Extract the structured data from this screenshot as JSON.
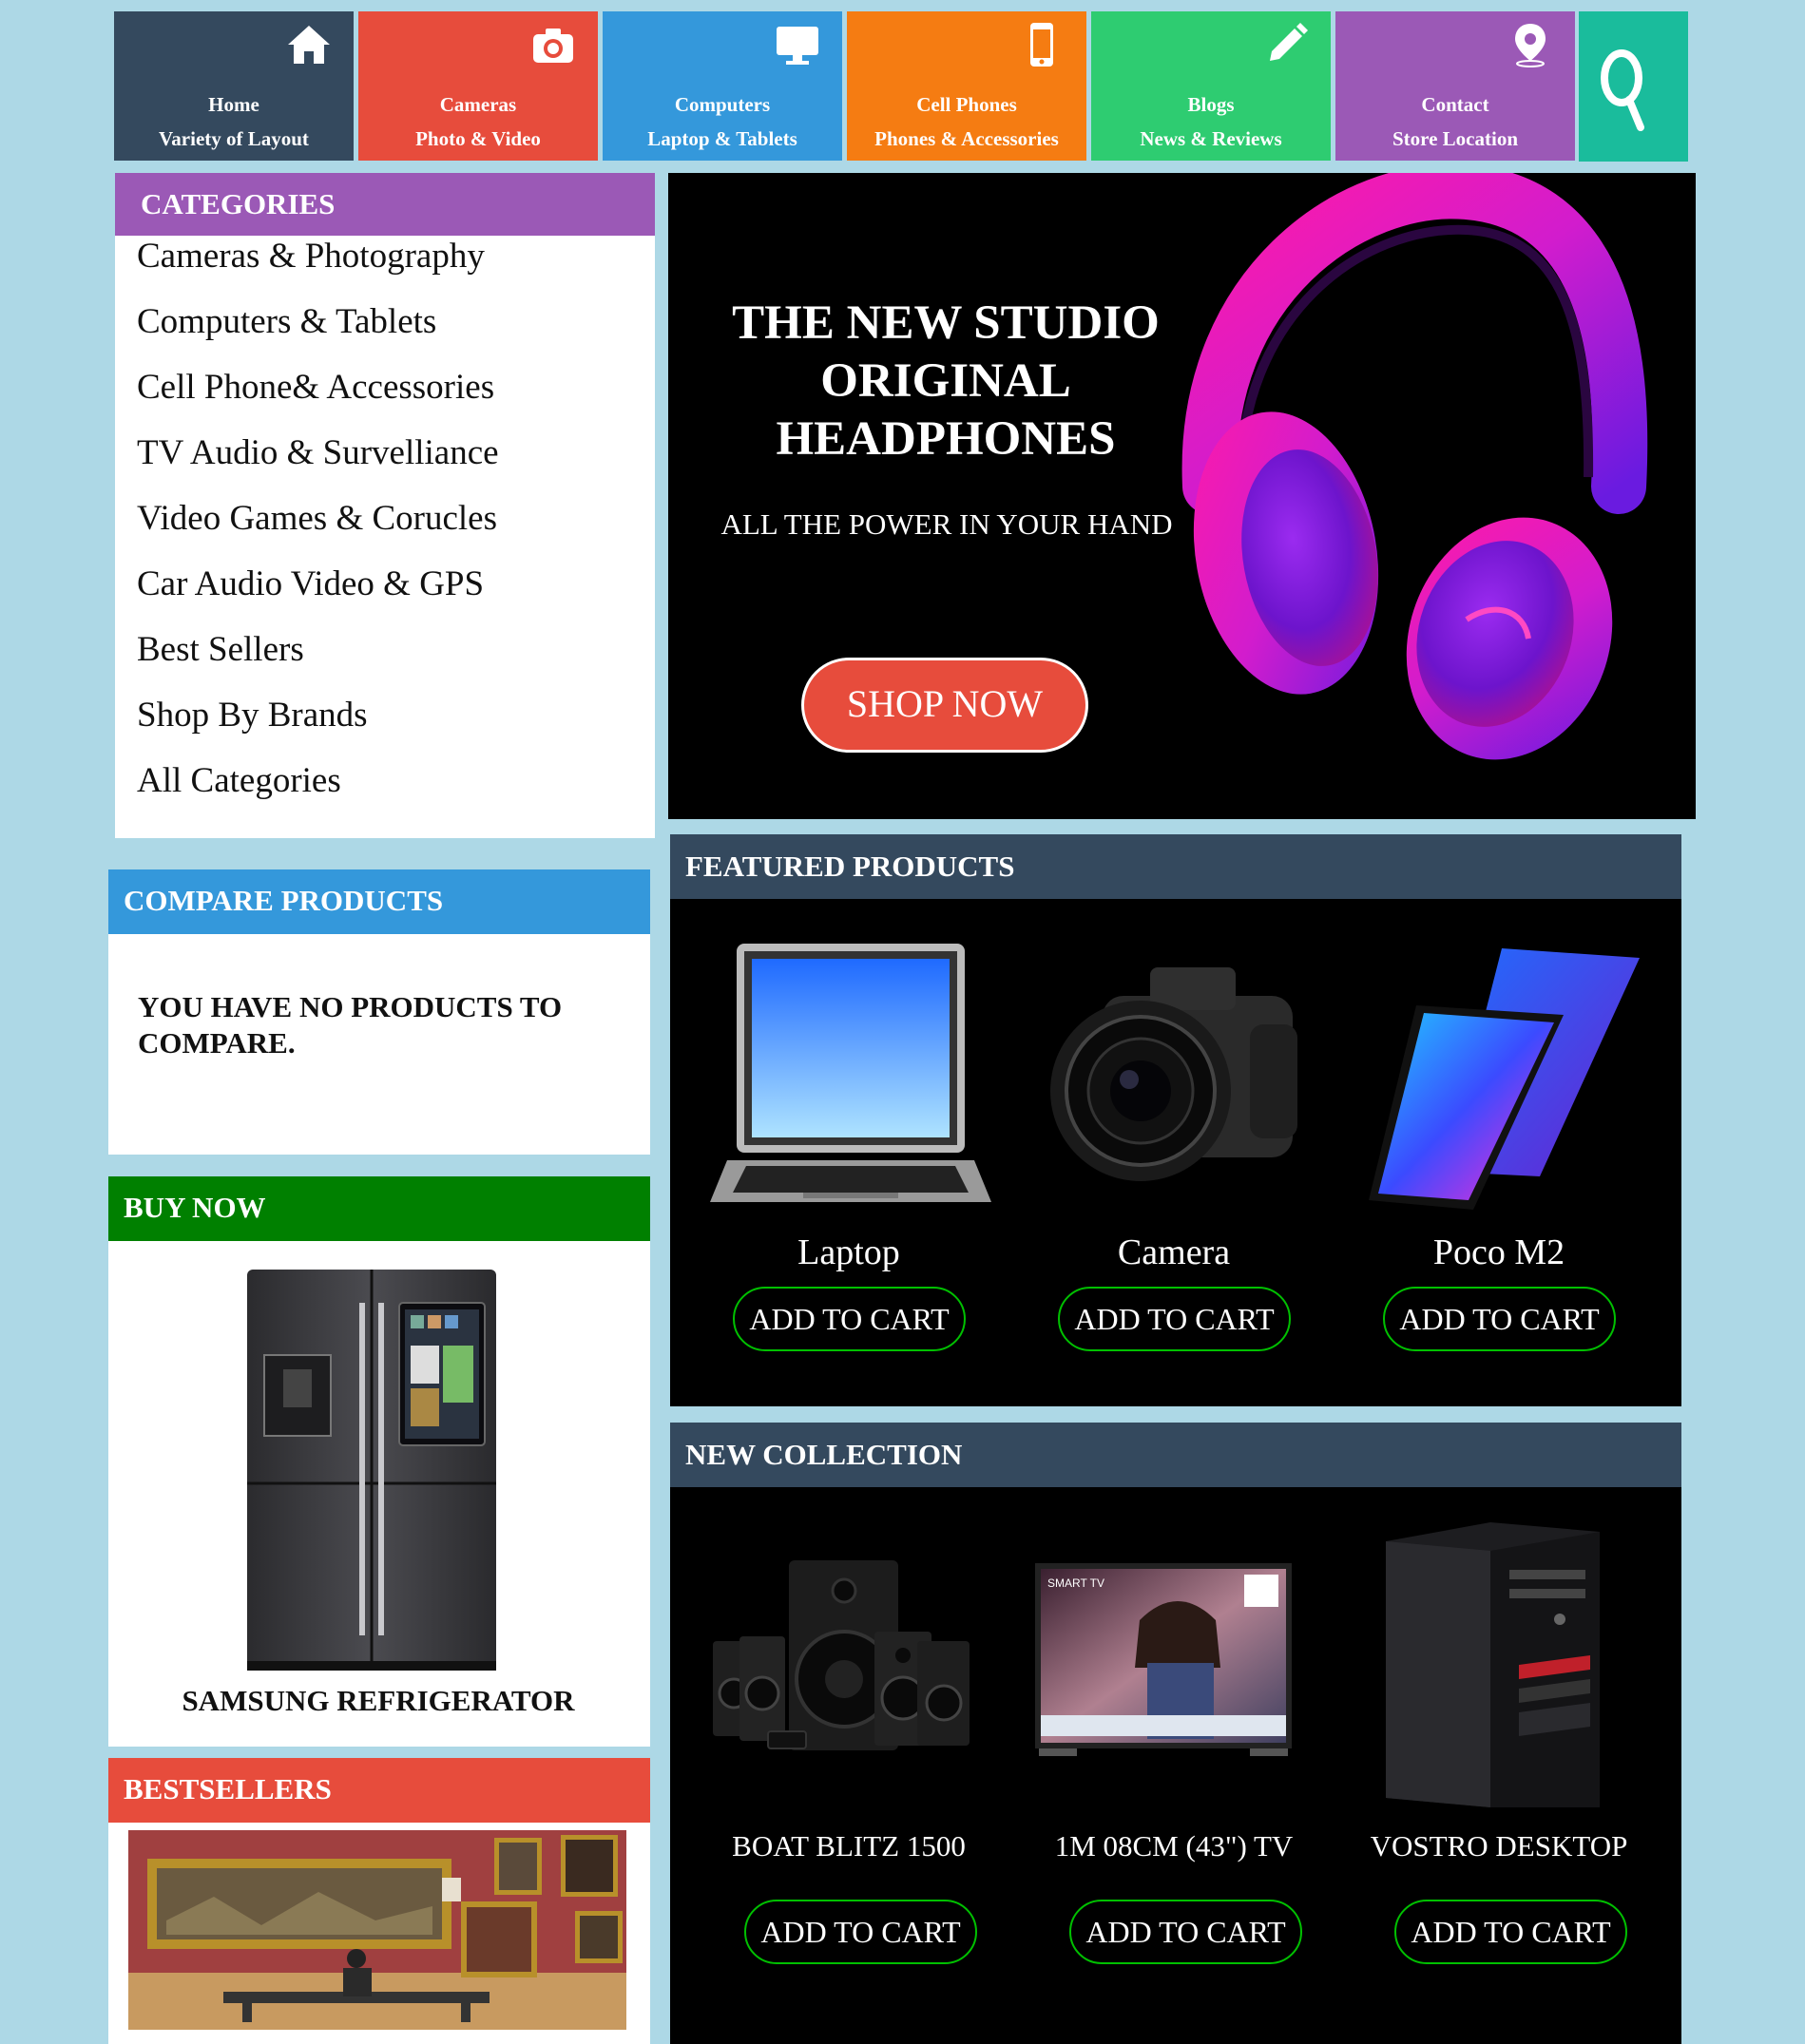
{
  "nav": [
    {
      "title": "Home",
      "subtitle": "Variety of Layout",
      "icon": "home-icon",
      "color": "#34495e"
    },
    {
      "title": "Cameras",
      "subtitle": "Photo & Video",
      "icon": "camera-icon",
      "color": "#e74c3c"
    },
    {
      "title": "Computers",
      "subtitle": "Laptop & Tablets",
      "icon": "monitor-icon",
      "color": "#3498db"
    },
    {
      "title": "Cell Phones",
      "subtitle": "Phones & Accessories",
      "icon": "phone-icon",
      "color": "#f57c12"
    },
    {
      "title": "Blogs",
      "subtitle": "News & Reviews",
      "icon": "pencil-icon",
      "color": "#2ecc71"
    },
    {
      "title": "Contact",
      "subtitle": "Store Location",
      "icon": "location-pin-icon",
      "color": "#9b59b6"
    }
  ],
  "search": {
    "icon": "search-icon",
    "color": "#1abc9c"
  },
  "categories": {
    "heading": "CATEGORIES",
    "color": "#9b59b6",
    "items": [
      "Cameras & Photography",
      "Computers & Tablets",
      "Cell Phone& Accessories",
      "TV Audio & Survelliance",
      "Video Games & Corucles",
      "Car Audio Video & GPS",
      "Best Sellers",
      "Shop By Brands",
      "All Categories"
    ]
  },
  "hero": {
    "title": "THE NEW STUDIO ORIGINAL HEADPHONES",
    "subtitle": "ALL THE POWER IN YOUR HAND",
    "button": "SHOP NOW",
    "image": "headphones-image"
  },
  "compare": {
    "heading": "COMPARE PRODUCTS",
    "color": "#3498db",
    "message": "YOU HAVE NO PRODUCTS TO COMPARE."
  },
  "buy_now": {
    "heading": "BUY NOW",
    "color": "#008000",
    "caption": "SAMSUNG REFRIGERATOR"
  },
  "bestsellers": {
    "heading": "BESTSELLERS",
    "color": "#e74c3c"
  },
  "featured": {
    "heading": "FEATURED PRODUCTS",
    "products": [
      {
        "name": "Laptop",
        "button": "ADD TO CART"
      },
      {
        "name": "Camera",
        "button": "ADD TO CART"
      },
      {
        "name": "Poco M2",
        "button": "ADD TO CART"
      }
    ]
  },
  "new_collection": {
    "heading": "NEW COLLECTION",
    "products": [
      {
        "name": "BOAT BLITZ 1500",
        "button": "ADD TO CART"
      },
      {
        "name": "1M 08CM (43\") TV",
        "button": "ADD TO CART"
      },
      {
        "name": "VOSTRO DESKTOP",
        "button": "ADD TO CART"
      }
    ]
  },
  "tv_overlay": {
    "smart": "SMART TV"
  }
}
